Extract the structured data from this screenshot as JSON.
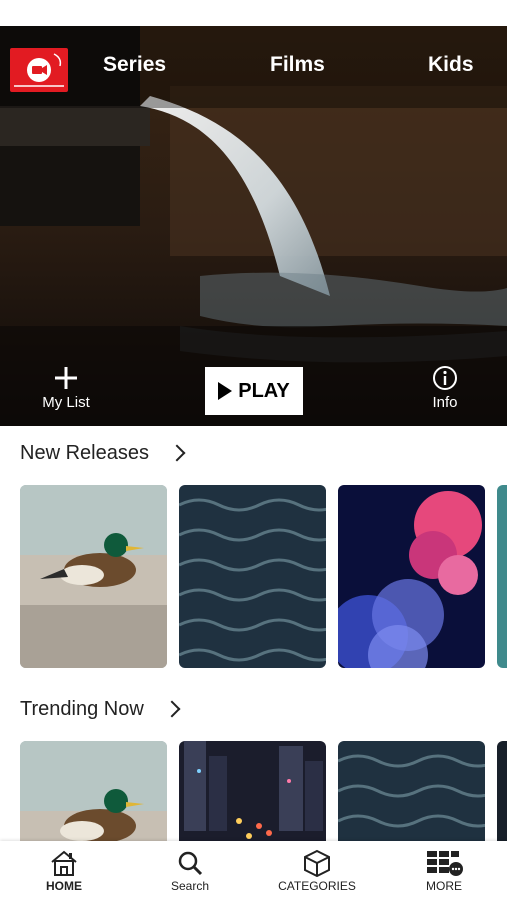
{
  "topnav": {
    "logo_icon": "video-camera-icon",
    "links": [
      "Series",
      "Films",
      "Kids"
    ]
  },
  "hero": {
    "mylist_label": "My List",
    "play_label": "PLAY",
    "info_label": "Info"
  },
  "sections": [
    {
      "title": "New Releases",
      "tiles": [
        "duck",
        "ocean-waves",
        "pink-blue-smoke",
        "teal-water"
      ]
    },
    {
      "title": "Trending Now",
      "tiles": [
        "duck",
        "city-night-street",
        "ocean-waves",
        "dark-partial"
      ]
    }
  ],
  "bottomnav": {
    "home": "HOME",
    "search": "Search",
    "categories": "CATEGORIES",
    "more": "MORE"
  },
  "colors": {
    "brand_red": "#e21b22",
    "text_dark": "#222222"
  }
}
